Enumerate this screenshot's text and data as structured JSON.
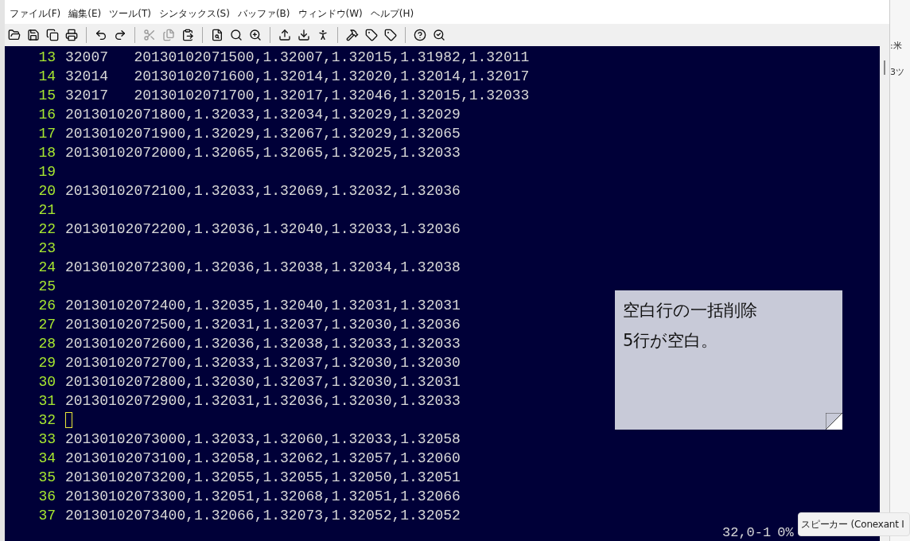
{
  "menu": [
    "ファイル(F)",
    "編集(E)",
    "ツール(T)",
    "シンタックス(S)",
    "バッファ(B)",
    "ウィンドウ(W)",
    "ヘルプ(H)"
  ],
  "lines": [
    {
      "number": "13",
      "text": "32007   20130102071500,1.32007,1.32015,1.31982,1.32011",
      "cursor": false
    },
    {
      "number": "14",
      "text": "32014   20130102071600,1.32014,1.32020,1.32014,1.32017",
      "cursor": false
    },
    {
      "number": "15",
      "text": "32017   20130102071700,1.32017,1.32046,1.32015,1.32033",
      "cursor": false
    },
    {
      "number": "16",
      "text": "20130102071800,1.32033,1.32034,1.32029,1.32029",
      "cursor": false
    },
    {
      "number": "17",
      "text": "20130102071900,1.32029,1.32067,1.32029,1.32065",
      "cursor": false
    },
    {
      "number": "18",
      "text": "20130102072000,1.32065,1.32065,1.32025,1.32033",
      "cursor": false
    },
    {
      "number": "19",
      "cursor": false
    },
    {
      "number": "20",
      "text": "20130102072100,1.32033,1.32069,1.32032,1.32036",
      "cursor": false
    },
    {
      "number": "21",
      "cursor": false
    },
    {
      "number": "22",
      "text": "20130102072200,1.32036,1.32040,1.32033,1.32036",
      "cursor": false
    },
    {
      "number": "23",
      "cursor": false
    },
    {
      "number": "24",
      "text": "20130102072300,1.32036,1.32038,1.32034,1.32038",
      "cursor": false
    },
    {
      "number": "25",
      "cursor": false
    },
    {
      "number": "26",
      "text": "20130102072400,1.32035,1.32040,1.32031,1.32031",
      "cursor": false
    },
    {
      "number": "27",
      "text": "20130102072500,1.32031,1.32037,1.32030,1.32036",
      "cursor": false
    },
    {
      "number": "28",
      "text": "20130102072600,1.32036,1.32038,1.32033,1.32033",
      "cursor": false
    },
    {
      "number": "29",
      "text": "20130102072700,1.32033,1.32037,1.32030,1.32030",
      "cursor": false
    },
    {
      "number": "30",
      "text": "20130102072800,1.32030,1.32037,1.32030,1.32031",
      "cursor": false
    },
    {
      "number": "31",
      "text": "20130102072900,1.32031,1.32036,1.32030,1.32033",
      "cursor": false
    },
    {
      "number": "32",
      "cursor": true
    },
    {
      "number": "33",
      "text": "20130102073000,1.32033,1.32060,1.32033,1.32058",
      "cursor": false
    },
    {
      "number": "34",
      "text": "20130102073100,1.32058,1.32062,1.32057,1.32060",
      "cursor": false
    },
    {
      "number": "35",
      "text": "20130102073200,1.32055,1.32055,1.32050,1.32051",
      "cursor": false
    },
    {
      "number": "36",
      "text": "20130102073300,1.32051,1.32068,1.32051,1.32066",
      "cursor": false
    },
    {
      "number": "37",
      "text": "20130102073400,1.32066,1.32073,1.32052,1.32052",
      "cursor": false
    }
  ],
  "note": [
    "空白行の一括削除",
    "5行が空白。"
  ],
  "status": {
    "position": "32,0-1",
    "percent": "0%"
  },
  "background_window": [
    ":米",
    "3ツ"
  ],
  "tooltip": "スピーカー (Conexant I"
}
